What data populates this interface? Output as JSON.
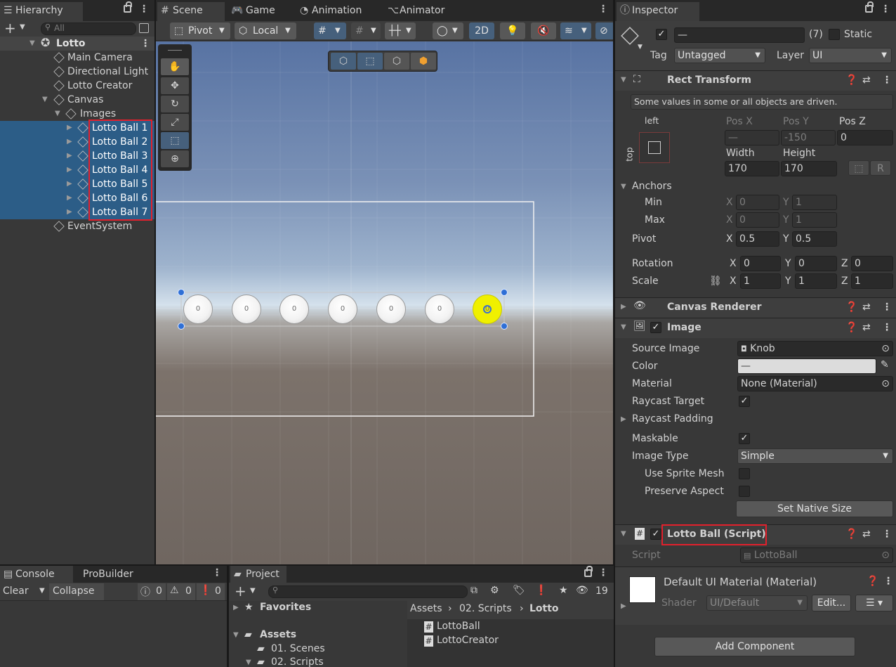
{
  "hierarchy": {
    "tab": "Hierarchy",
    "search_placeholder": "All",
    "items": [
      {
        "label": "Lotto",
        "bold": true
      },
      {
        "label": "Main Camera"
      },
      {
        "label": "Directional Light"
      },
      {
        "label": "Lotto Creator"
      },
      {
        "label": "Canvas"
      },
      {
        "label": "Images"
      },
      {
        "label": "Lotto Ball 1"
      },
      {
        "label": "Lotto Ball 2"
      },
      {
        "label": "Lotto Ball 3"
      },
      {
        "label": "Lotto Ball 4"
      },
      {
        "label": "Lotto Ball 5"
      },
      {
        "label": "Lotto Ball 6"
      },
      {
        "label": "Lotto Ball 7"
      },
      {
        "label": "EventSystem"
      }
    ]
  },
  "scene": {
    "tabs": [
      "Scene",
      "Game",
      "Animation",
      "Animator"
    ],
    "pivot": "Pivot",
    "local": "Local",
    "mode_2d": "2D",
    "balls": [
      "0",
      "0",
      "0",
      "0",
      "0",
      "0",
      "0"
    ]
  },
  "inspector": {
    "tab": "Inspector",
    "name_value": "—",
    "count": "(7)",
    "static_label": "Static",
    "tag_label": "Tag",
    "tag_value": "Untagged",
    "layer_label": "Layer",
    "layer_value": "UI",
    "rect_transform": {
      "title": "Rect Transform",
      "note": "Some values in some or all objects are driven.",
      "anchor_h": "left",
      "anchor_v": "top",
      "posx_label": "Pos X",
      "posx": "—",
      "posy_label": "Pos Y",
      "posy": "-150",
      "posz_label": "Pos Z",
      "posz": "0",
      "width_label": "Width",
      "width": "170",
      "height_label": "Height",
      "height": "170",
      "anchors_label": "Anchors",
      "min_label": "Min",
      "min_x": "0",
      "min_y": "1",
      "max_label": "Max",
      "max_x": "0",
      "max_y": "1",
      "pivot_label": "Pivot",
      "pivot_x": "0.5",
      "pivot_y": "0.5",
      "rotation_label": "Rotation",
      "rot_x": "0",
      "rot_y": "0",
      "rot_z": "0",
      "scale_label": "Scale",
      "scale_x": "1",
      "scale_y": "1",
      "scale_z": "1",
      "reset_btn": "R"
    },
    "canvas_renderer": "Canvas Renderer",
    "image": {
      "title": "Image",
      "source_label": "Source Image",
      "source_value": "Knob",
      "color_label": "Color",
      "color_value": "—",
      "material_label": "Material",
      "material_value": "None (Material)",
      "raycast_label": "Raycast Target",
      "raycast_padding": "Raycast Padding",
      "maskable_label": "Maskable",
      "type_label": "Image Type",
      "type_value": "Simple",
      "sprite_mesh": "Use Sprite Mesh",
      "preserve": "Preserve Aspect",
      "native_btn": "Set Native Size"
    },
    "script": {
      "title": "Lotto Ball (Script)",
      "script_label": "Script",
      "script_value": "LottoBall"
    },
    "material": {
      "title": "Default UI Material (Material)",
      "shader_label": "Shader",
      "shader_value": "UI/Default",
      "edit_btn": "Edit..."
    },
    "add_component": "Add Component"
  },
  "console": {
    "tabs": [
      "Console",
      "ProBuilder"
    ],
    "clear": "Clear",
    "collapse": "Collapse",
    "counts": [
      "0",
      "0",
      "0"
    ]
  },
  "project": {
    "tab": "Project",
    "count": "19",
    "favorites": "Favorites",
    "assets": "Assets",
    "scenes": "01. Scenes",
    "scripts": "02. Scripts",
    "breadcrumb": [
      "Assets",
      "02. Scripts",
      "Lotto"
    ],
    "files": [
      "LottoBall",
      "LottoCreator"
    ]
  },
  "colors": {
    "selection": "#2c5d87",
    "accent_red": "#e2202c",
    "ball_yellow": "#f0f000"
  }
}
